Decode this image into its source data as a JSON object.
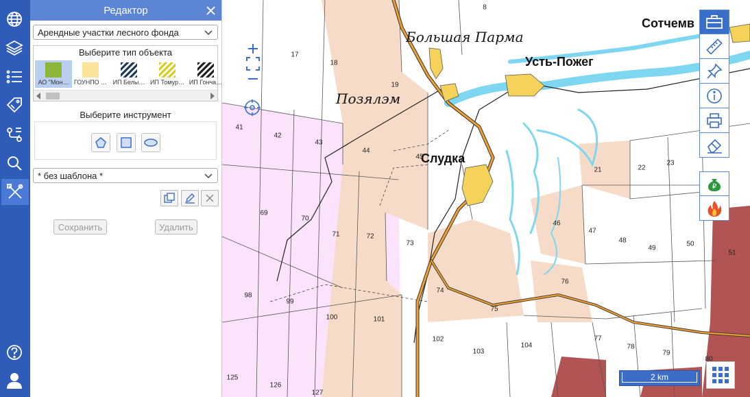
{
  "left_toolbar": {
    "items": [
      {
        "icon": "globe-icon"
      },
      {
        "icon": "layers-icon"
      },
      {
        "icon": "list-icon"
      },
      {
        "icon": "tag-icon"
      },
      {
        "icon": "route-icon"
      },
      {
        "icon": "search-icon"
      },
      {
        "icon": "tools-icon",
        "active": true
      },
      {
        "icon": "help-icon"
      },
      {
        "icon": "user-icon"
      }
    ]
  },
  "editor": {
    "title": "Редактор",
    "layer_select": "Арендные участки лесного фонда",
    "object_type_caption": "Выберите тип объекта",
    "object_types": [
      {
        "label": "АО \"Мон…",
        "swatch": "solid",
        "color": "#8db53a",
        "selected": true
      },
      {
        "label": "ГОУНПО …",
        "swatch": "solid",
        "color": "#fce39a"
      },
      {
        "label": "ИП Белы…",
        "swatch": "hatch",
        "color": "#1d3a5c"
      },
      {
        "label": "ИП Томур…",
        "swatch": "hatch",
        "color": "#d9cc1e"
      },
      {
        "label": "ИП Гонча…",
        "swatch": "hatch",
        "color": "#222222"
      }
    ],
    "tool_caption": "Выберите инструмент",
    "tools": [
      {
        "icon": "polygon-tool-icon"
      },
      {
        "icon": "rectangle-tool-icon"
      },
      {
        "icon": "ellipse-tool-icon"
      }
    ],
    "template_select": "* без шаблона *",
    "save_label": "Сохранить",
    "delete_label": "Удалить"
  },
  "map": {
    "places": [
      {
        "name": "Большая Парма",
        "style": "italic"
      },
      {
        "name": "Усть-Пожег",
        "style": "bold"
      },
      {
        "name": "Позялэм",
        "style": "italic"
      },
      {
        "name": "Слудка",
        "style": "bold"
      },
      {
        "name": "Сотчемв",
        "style": "bold"
      }
    ],
    "parcels": [
      "8",
      "17",
      "18",
      "19",
      "41",
      "42",
      "43",
      "44",
      "45",
      "21",
      "22",
      "23",
      "46",
      "47",
      "48",
      "49",
      "50",
      "51",
      "69",
      "70",
      "71",
      "72",
      "73",
      "74",
      "75",
      "76",
      "98",
      "99",
      "100",
      "101",
      "102",
      "103",
      "104",
      "77",
      "78",
      "79",
      "80",
      "125",
      "126",
      "127"
    ],
    "scale_label": "2 km",
    "colors": {
      "forest_lease": "#f6dcc8",
      "pink_zone": "#fbe3fb",
      "dark_red_zone": "#b35454",
      "water": "#7fd6f0",
      "road": "#f0a030",
      "settlement": "#f5d35a"
    }
  },
  "right_toolbar": {
    "items": [
      {
        "icon": "toolbox-icon",
        "active": true
      },
      {
        "icon": "ruler-icon"
      },
      {
        "icon": "pin-icon"
      },
      {
        "icon": "info-icon"
      },
      {
        "icon": "print-icon"
      },
      {
        "icon": "eraser-icon"
      }
    ],
    "extra": [
      {
        "icon": "money-bag-icon"
      },
      {
        "icon": "fire-icon"
      }
    ]
  }
}
